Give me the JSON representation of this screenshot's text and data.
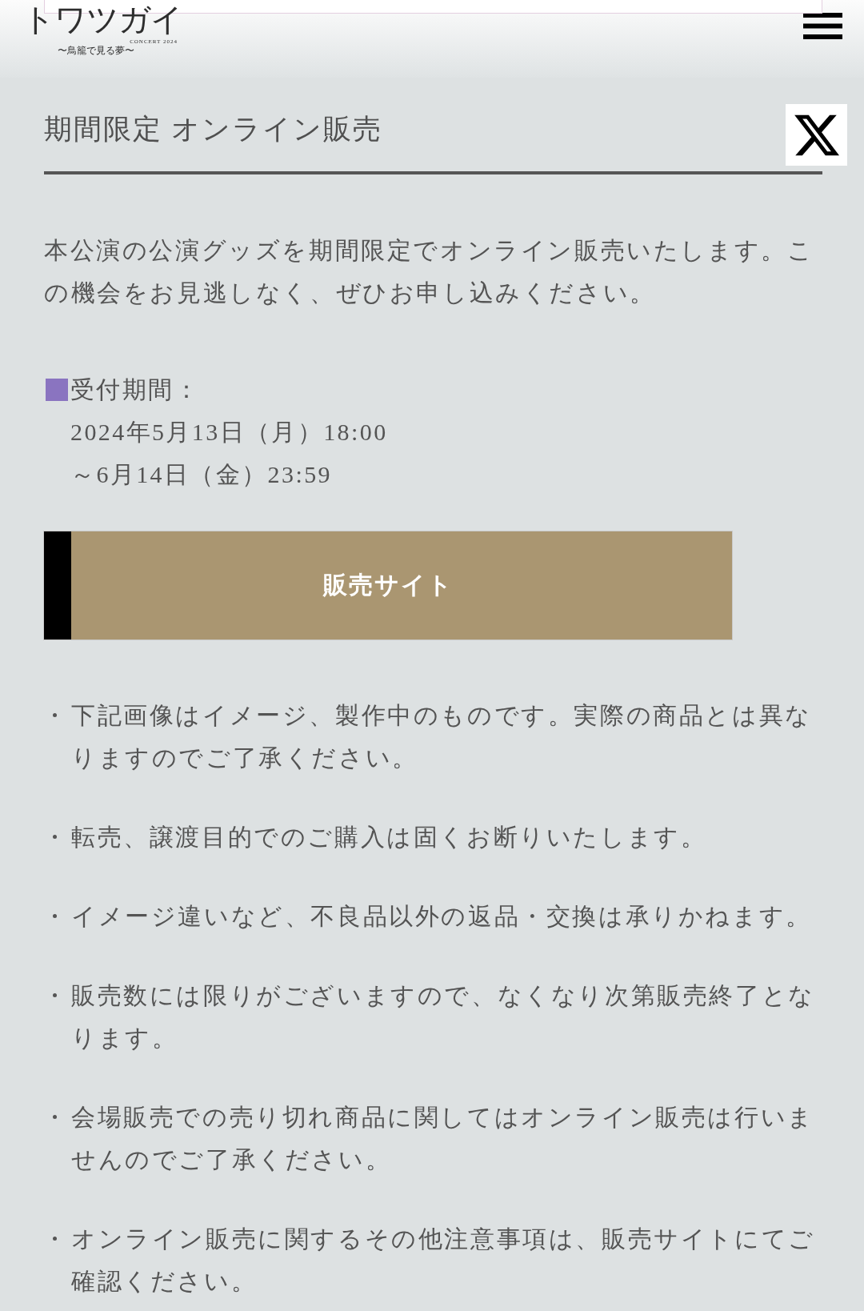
{
  "header": {
    "logo": {
      "title": "トワツガイ",
      "tagline": "CONCERT 2024",
      "subtitle": "〜鳥籠で見る夢〜"
    }
  },
  "section": {
    "title": "期間限定 オンライン販売",
    "intro": "本公演の公演グッズを期間限定でオンライン販売いたします。この機会をお見逃しなく、ぜひお申し込みください。",
    "period": {
      "label": "受付期間：",
      "lines": [
        "2024年5月13日（月）18:00",
        "～6月14日（金）23:59"
      ]
    },
    "button": {
      "label": "販売サイト"
    },
    "notes": [
      "下記画像はイメージ、製作中のものです。実際の商品とは異なりますのでご了承ください。",
      "転売、譲渡目的でのご購入は固くお断りいたします。",
      "イメージ違いなど、不良品以外の返品・交換は承りかねます。",
      "販売数には限りがございますので、なくなり次第販売終了となります。",
      "会場販売での売り切れ商品に関してはオンライン販売は行いませんのでご了承ください。",
      "オンライン販売に関するその他注意事項は、販売サイトにてご確認ください。"
    ]
  }
}
